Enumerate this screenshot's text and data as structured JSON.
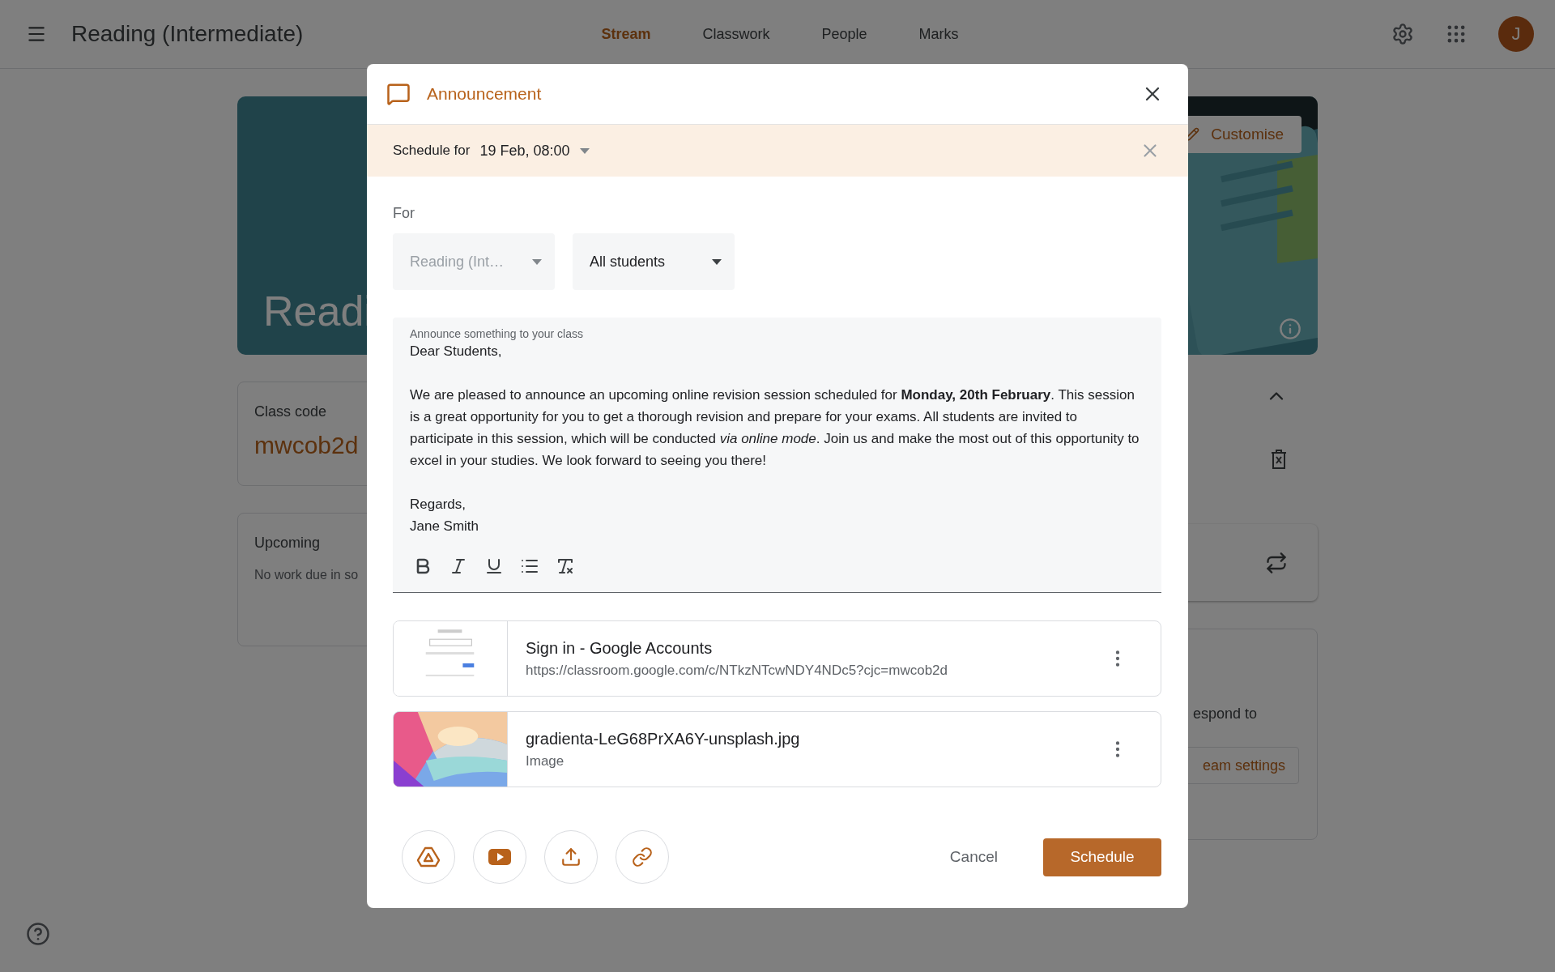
{
  "header": {
    "title": "Reading (Intermediate)",
    "tabs": [
      {
        "label": "Stream",
        "selected": true
      },
      {
        "label": "Classwork",
        "selected": false
      },
      {
        "label": "People",
        "selected": false
      },
      {
        "label": "Marks",
        "selected": false
      }
    ],
    "avatar": "J"
  },
  "banner": {
    "title": "Readi",
    "customise": "Customise"
  },
  "class_code": {
    "label": "Class code",
    "code": "mwcob2d"
  },
  "upcoming": {
    "title": "Upcoming",
    "text": "No work due in so"
  },
  "stream_card": {
    "text": "espond to",
    "button": "eam settings"
  },
  "dialog": {
    "title": "Announcement",
    "schedule": {
      "label": "Schedule for",
      "value": "19 Feb, 08:00"
    },
    "for_label": "For",
    "audience": [
      {
        "value": "Reading (Int…",
        "disabled": true
      },
      {
        "value": "All students",
        "disabled": false
      }
    ],
    "editor": {
      "label": "Announce something to your class",
      "paragraphs": [
        [
          "Dear Students,"
        ],
        [
          "We are pleased to announce an upcoming online revision session scheduled for **Monday, 20th February**. This session is a great opportunity for you to get a thorough revision and prepare for your exams. All students are invited to participate in this session, which will be conducted *via online mode*. Join us and make the most out of this opportunity to excel in your studies. We look forward to seeing you there!"
        ],
        [
          "Regards,",
          "Jane Smith"
        ]
      ]
    },
    "attachments": [
      {
        "kind": "link",
        "title": "Sign in - Google Accounts",
        "subtitle": "https://classroom.google.com/c/NTkzNTcwNDY4NDc5?cjc=mwcob2d"
      },
      {
        "title": "gradienta-LeG68PrXA6Y-unsplash.jpg",
        "subtitle": "Image"
      }
    ],
    "actions": {
      "cancel": "Cancel",
      "submit": "Schedule"
    }
  }
}
